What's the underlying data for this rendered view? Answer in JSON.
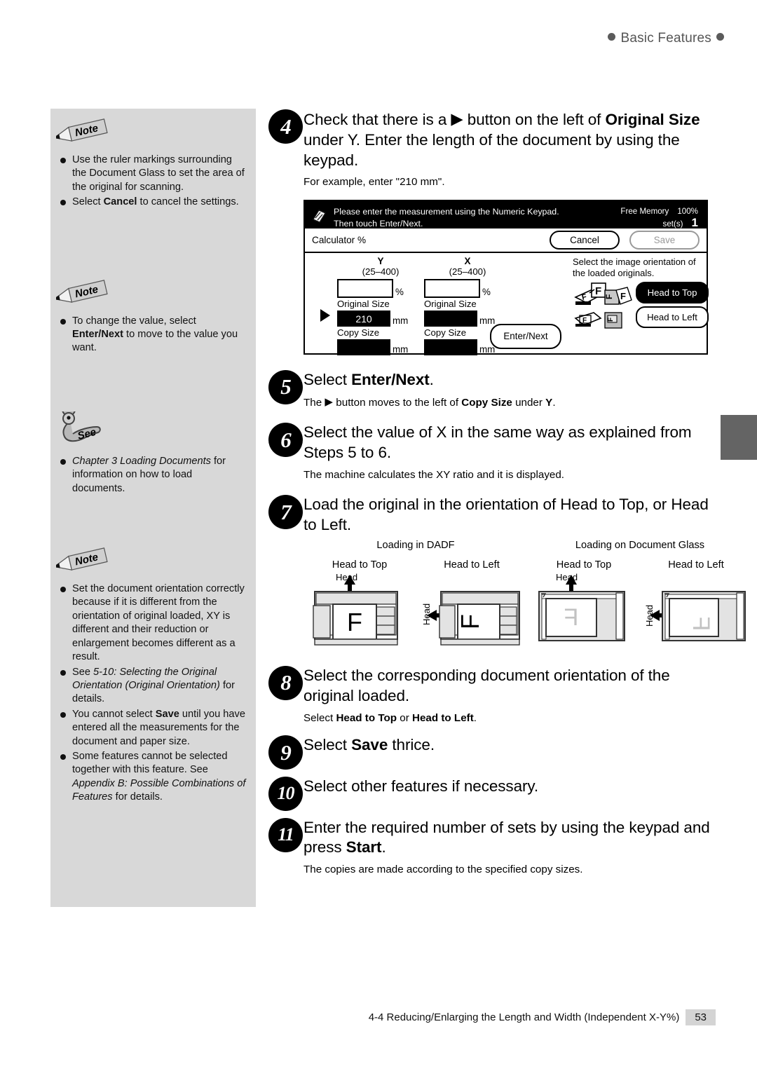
{
  "header": {
    "title": "Basic Features"
  },
  "sidebar": {
    "blocks": [
      {
        "badge": "Note",
        "badge_icon": "pencil-note-icon",
        "items": [
          {
            "segments": [
              {
                "t": "Use the ruler markings surrounding the Document Glass to set the area of the original for scanning.",
                "s": "n"
              }
            ]
          },
          {
            "segments": [
              {
                "t": "Select ",
                "s": "n"
              },
              {
                "t": "Cancel",
                "s": "b"
              },
              {
                "t": " to cancel the settings.",
                "s": "n"
              }
            ]
          }
        ]
      },
      {
        "badge": "Note",
        "badge_icon": "pencil-note-icon",
        "items": [
          {
            "segments": [
              {
                "t": "To change the value, select ",
                "s": "n"
              },
              {
                "t": "Enter/",
                "s": "b"
              },
              {
                "t": "Next",
                "s": "b"
              },
              {
                "t": " to move to the value you want.",
                "s": "n"
              }
            ]
          }
        ]
      },
      {
        "badge": "See",
        "badge_icon": "binder-clip-see-icon",
        "items": [
          {
            "segments": [
              {
                "t": "Chapter 3 Loading Documents",
                "s": "i"
              },
              {
                "t": " for information on how to load documents.",
                "s": "n"
              }
            ]
          }
        ]
      },
      {
        "badge": "Note",
        "badge_icon": "pencil-note-icon",
        "items": [
          {
            "segments": [
              {
                "t": "Set the document orientation correctly because if it is different from the orientation of original loaded, XY is different and their reduction or enlargement becomes different as a result.",
                "s": "n"
              }
            ]
          },
          {
            "segments": [
              {
                "t": "See ",
                "s": "n"
              },
              {
                "t": "5-10: Selecting the Original Orientation (Original Orientation)",
                "s": "i"
              },
              {
                "t": " for details.",
                "s": "n"
              }
            ]
          },
          {
            "segments": [
              {
                "t": "You cannot select ",
                "s": "n"
              },
              {
                "t": "Save",
                "s": "b"
              },
              {
                "t": " until you have entered all the measurements for the document and paper size.",
                "s": "n"
              }
            ]
          },
          {
            "segments": [
              {
                "t": "Some features cannot be selected together with this feature. See ",
                "s": "n"
              },
              {
                "t": "Appendix B: Possible Combinations of Features",
                "s": "i"
              },
              {
                "t": " for details.",
                "s": "n"
              }
            ]
          }
        ]
      }
    ]
  },
  "steps": [
    {
      "num": "4",
      "title_segments": [
        {
          "t": "Check that there is a ",
          "s": "n"
        },
        {
          "t": "▶",
          "s": "tri"
        },
        {
          "t": " button on the left of ",
          "s": "n"
        },
        {
          "t": "Original Size",
          "s": "b"
        },
        {
          "t": " under Y. Enter the length of the document by using the keypad.",
          "s": "n"
        }
      ],
      "sub_segments": [
        {
          "t": "For example, enter \"210 mm\".",
          "s": "n"
        }
      ]
    },
    {
      "num": "5",
      "title_segments": [
        {
          "t": "Select ",
          "s": "n"
        },
        {
          "t": "Enter/Next",
          "s": "b"
        },
        {
          "t": ".",
          "s": "n"
        }
      ],
      "sub_segments": [
        {
          "t": "The ",
          "s": "n"
        },
        {
          "t": "▶",
          "s": "tri"
        },
        {
          "t": " button moves to the left of ",
          "s": "n"
        },
        {
          "t": "Copy Size",
          "s": "b"
        },
        {
          "t": " under ",
          "s": "n"
        },
        {
          "t": "Y",
          "s": "b"
        },
        {
          "t": ".",
          "s": "n"
        }
      ]
    },
    {
      "num": "6",
      "title_segments": [
        {
          "t": "Select the value of X in the same way as explained from Steps 5 to 6.",
          "s": "n"
        }
      ],
      "sub_segments": [
        {
          "t": "The machine calculates the XY ratio and it is displayed.",
          "s": "n"
        }
      ]
    },
    {
      "num": "7",
      "title_segments": [
        {
          "t": "Load the original in the orientation of Head to Top, or Head to Left.",
          "s": "n"
        }
      ],
      "sub_segments": []
    },
    {
      "num": "8",
      "title_segments": [
        {
          "t": "Select the corresponding document orientation of the original loaded.",
          "s": "n"
        }
      ],
      "sub_segments": [
        {
          "t": "Select ",
          "s": "n"
        },
        {
          "t": "Head to Top",
          "s": "b"
        },
        {
          "t": " or ",
          "s": "n"
        },
        {
          "t": "Head to Left",
          "s": "b"
        },
        {
          "t": ".",
          "s": "n"
        }
      ]
    },
    {
      "num": "9",
      "title_segments": [
        {
          "t": "Select ",
          "s": "n"
        },
        {
          "t": "Save",
          "s": "b"
        },
        {
          "t": " thrice.",
          "s": "n"
        }
      ],
      "sub_segments": []
    },
    {
      "num": "10",
      "title_segments": [
        {
          "t": "Select other features if necessary.",
          "s": "n"
        }
      ],
      "sub_segments": []
    },
    {
      "num": "11",
      "title_segments": [
        {
          "t": "Enter the required number of sets by using the keypad and press ",
          "s": "n"
        },
        {
          "t": "Start",
          "s": "b"
        },
        {
          "t": ".",
          "s": "n"
        }
      ],
      "sub_segments": [
        {
          "t": "The copies are made according to the specified copy sizes.",
          "s": "n"
        }
      ]
    }
  ],
  "ui_panel": {
    "message_line1": "Please enter the measurement using the Numeric Keypad.",
    "message_line2": "Then touch Enter/Next.",
    "free_memory_label": "Free Memory",
    "free_memory_value": "100%",
    "sets_label": "set(s)",
    "sets_value": "1",
    "mode_label": "Calculator %",
    "cancel_label": "Cancel",
    "save_label": "Save",
    "columns": [
      {
        "axis": "Y",
        "range": "(25–400)",
        "percent_value": "",
        "percent_unit": "%",
        "original_size_label": "Original Size",
        "original_size_value": "210",
        "original_size_unit": "mm",
        "copy_size_label": "Copy Size",
        "copy_size_value": "",
        "copy_size_unit": "mm"
      },
      {
        "axis": "X",
        "range": "(25–400)",
        "percent_value": "",
        "percent_unit": "%",
        "original_size_label": "Original Size",
        "original_size_value": "",
        "original_size_unit": "mm",
        "copy_size_label": "Copy Size",
        "copy_size_value": "",
        "copy_size_unit": "mm"
      }
    ],
    "enter_next_label": "Enter/Next",
    "orientation_hint": "Select the image orientation of the loaded originals.",
    "head_to_top_label": "Head to Top",
    "head_to_left_label": "Head to Left",
    "selected_orientation": "Head to Top"
  },
  "diagrams": {
    "group1_title": "Loading in DADF",
    "group2_title": "Loading on Document Glass",
    "cells": [
      {
        "caption": "Head to Top",
        "head_label": "Head",
        "letter": "F"
      },
      {
        "caption": "Head to Left",
        "head_label": "Head",
        "letter": "F"
      },
      {
        "caption": "Head to Top",
        "head_label": "Head",
        "letter": "F"
      },
      {
        "caption": "Head to Left",
        "head_label": "Head",
        "letter": "F"
      }
    ]
  },
  "footer": {
    "section": "4-4  Reducing/Enlarging the Length and Width (Independent X-Y%)",
    "page": "53"
  },
  "colors": {
    "sidebar_bg": "#d8d8d8",
    "header_text": "#555555",
    "tab_gray": "#646464",
    "page_box": "#d4d4d4"
  }
}
